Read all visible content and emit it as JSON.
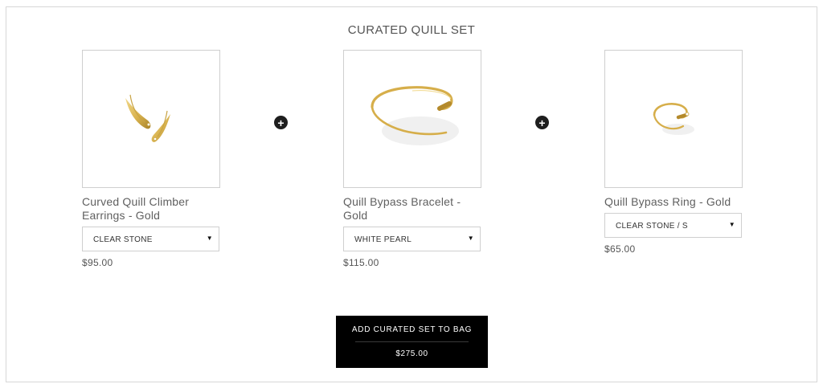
{
  "section": {
    "title": "CURATED QUILL SET"
  },
  "products": [
    {
      "name": "Curved Quill Climber Earrings - Gold",
      "option": "CLEAR STONE",
      "price": "$95.00",
      "image_icon": "quill-climber-earrings-image"
    },
    {
      "name": "Quill Bypass Bracelet - Gold",
      "option": "WHITE PEARL",
      "price": "$115.00",
      "image_icon": "quill-bypass-bracelet-image"
    },
    {
      "name": "Quill Bypass Ring - Gold",
      "option": "CLEAR STONE / S",
      "price": "$65.00",
      "image_icon": "quill-bypass-ring-image"
    }
  ],
  "add_to_bag": {
    "label": "ADD CURATED SET TO BAG",
    "total": "$275.00"
  },
  "colors": {
    "gold": "#d8b24e",
    "button_bg": "#000000",
    "plus_icon": "#1e1e1e"
  }
}
